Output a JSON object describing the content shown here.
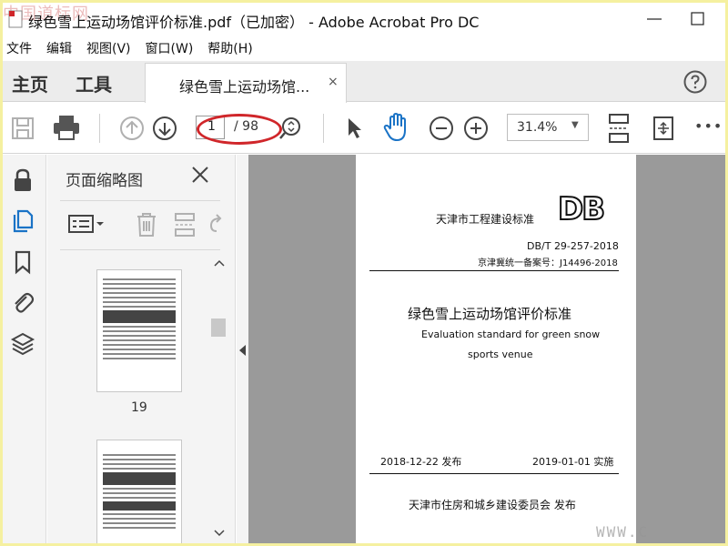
{
  "window": {
    "title": "绿色雪上运动场馆评价标准.pdf（已加密） - Adobe Acrobat Pro DC",
    "watermark_top": "中国道标网",
    "watermark_bottom": "WWW.C"
  },
  "menu": [
    "文件",
    "编辑",
    "视图(V)",
    "窗口(W)",
    "帮助(H)"
  ],
  "tabs": {
    "home": "主页",
    "tools": "工具",
    "doc_tab": "绿色雪上运动场馆...",
    "doc_close": "×"
  },
  "toolbar": {
    "page_current": "1",
    "page_total": "/ 98",
    "zoom": "31.4%",
    "zoom_dropdown": "▼",
    "more": "•••"
  },
  "thumbnails": {
    "title": "页面缩略图",
    "pages": [
      {
        "label": "19"
      }
    ]
  },
  "document": {
    "issuer": "天津市工程建设标准",
    "logo": "DB",
    "code1": "DB/T 29-257-2018",
    "code2": "京津冀统一备案号：J14496-2018",
    "title_cn": "绿色雪上运动场馆评价标准",
    "title_en_1": "Evaluation standard for green snow",
    "title_en_2": "sports venue",
    "issue_date": "2018-12-22  发布",
    "effective_date": "2019-01-01  实施",
    "publisher": "天津市住房和城乡建设委员会    发布"
  },
  "colors": {
    "accent_blue": "#1a73c6",
    "highlight_red": "#d0262a",
    "frame_yellow": "#f5f0a0"
  }
}
